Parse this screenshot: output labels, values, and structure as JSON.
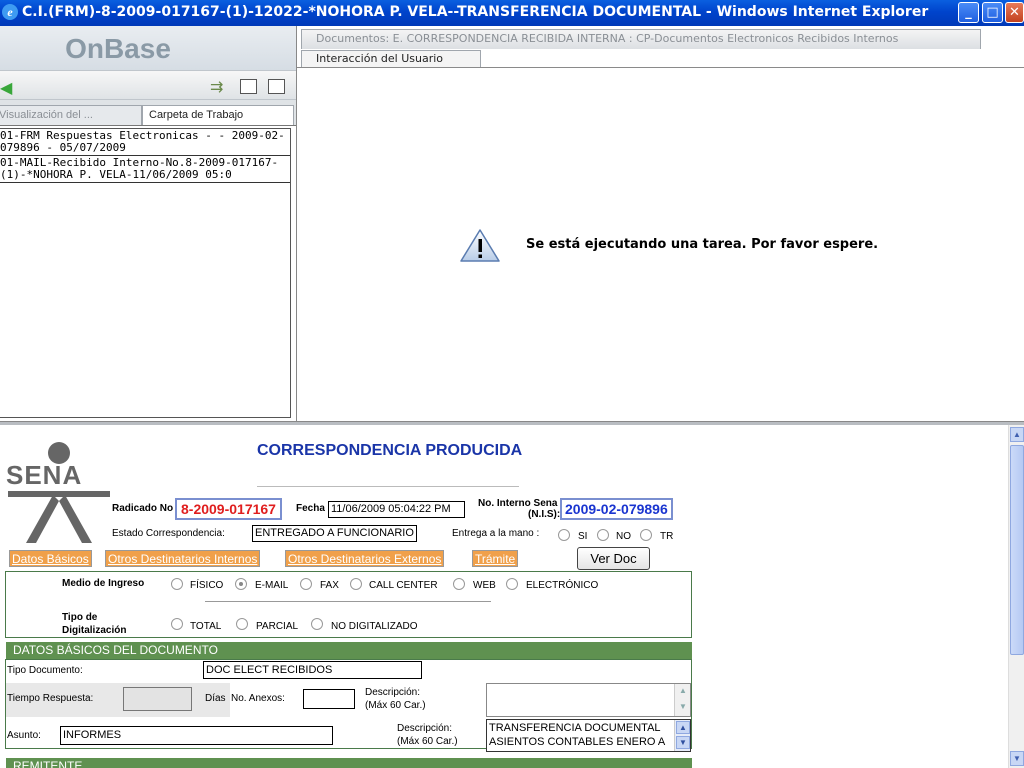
{
  "window": {
    "title": "C.I.(FRM)-8-2009-017167-(1)-12022-*NOHORA P. VELA--TRANSFERENCIA DOCUMENTAL - Windows Internet Explorer"
  },
  "left_panel": {
    "brand": "OnBase",
    "tabs": [
      "Visualización del ...",
      "Carpeta de Trabajo"
    ],
    "items": [
      "01-FRM Respuestas Electronicas - - 2009-02-\n079896 - 05/07/2009",
      "01-MAIL-Recibido Interno-No.8-2009-017167-\n(1)-*NOHORA P. VELA-11/06/2009 05:0"
    ]
  },
  "right_panel": {
    "doc_tab": "Documentos: E. CORRESPONDENCIA RECIBIDA INTERNA : CP-Documentos Electronicos Recibidos Internos",
    "interaction_tab": "Interacción del Usuario",
    "wait_message": "Se está ejecutando una tarea. Por favor espere."
  },
  "form": {
    "logo_text": "SENA",
    "title": "CORRESPONDENCIA PRODUCIDA",
    "radicado_label": "Radicado No",
    "radicado_value": "8-2009-017167",
    "fecha_label": "Fecha",
    "fecha_value": "11/06/2009 05:04:22 PM",
    "nis_label": "No. Interno Sena",
    "nis_label2": "(N.I.S):",
    "nis_value": "2009-02-079896",
    "estado_label": "Estado Correspondencia:",
    "estado_value": "ENTREGADO A FUNCIONARIO",
    "entrega_label": "Entrega a la mano :",
    "entrega_options": [
      "SI",
      "NO",
      "TR"
    ],
    "tabs": [
      "Datos Básicos",
      "Otros Destinatarios Internos",
      "Otros Destinatarios Externos",
      "Trámite"
    ],
    "ver_doc": "Ver Doc",
    "medio_label": "Medio de Ingreso",
    "medio_options": [
      "FÍSICO",
      "E-MAIL",
      "FAX",
      "CALL CENTER",
      "WEB",
      "ELECTRÓNICO"
    ],
    "medio_selected": "E-MAIL",
    "tipo_dig_label_1": "Tipo de",
    "tipo_dig_label_2": "Digitalización",
    "tipo_dig_options": [
      "TOTAL",
      "PARCIAL",
      "NO DIGITALIZADO"
    ],
    "section_basic": "DATOS BÁSICOS DEL DOCUMENTO",
    "tipo_doc_label": "Tipo Documento:",
    "tipo_doc_value": "DOC ELECT RECIBIDOS",
    "tiempo_label": "Tiempo Respuesta:",
    "dias_label": "Días",
    "anexos_label": "No. Anexos:",
    "desc_label_1": "Descripción:",
    "desc_label_2": "(Máx 60 Car.)",
    "asunto_label": "Asunto:",
    "asunto_value": "INFORMES",
    "desc2_label_1": "Descripción:",
    "desc2_label_2": "(Máx 60 Car.)",
    "desc2_value_1": "TRANSFERENCIA DOCUMENTAL",
    "desc2_value_2": "ASIENTOS CONTABLES ENERO A",
    "section_remitente": "REMITENTE"
  },
  "colors": {
    "title_blue": "#1a35a8",
    "radicado_red": "#e01e1e",
    "tab_orange": "#f0a04a",
    "section_green": "#5f9150"
  }
}
